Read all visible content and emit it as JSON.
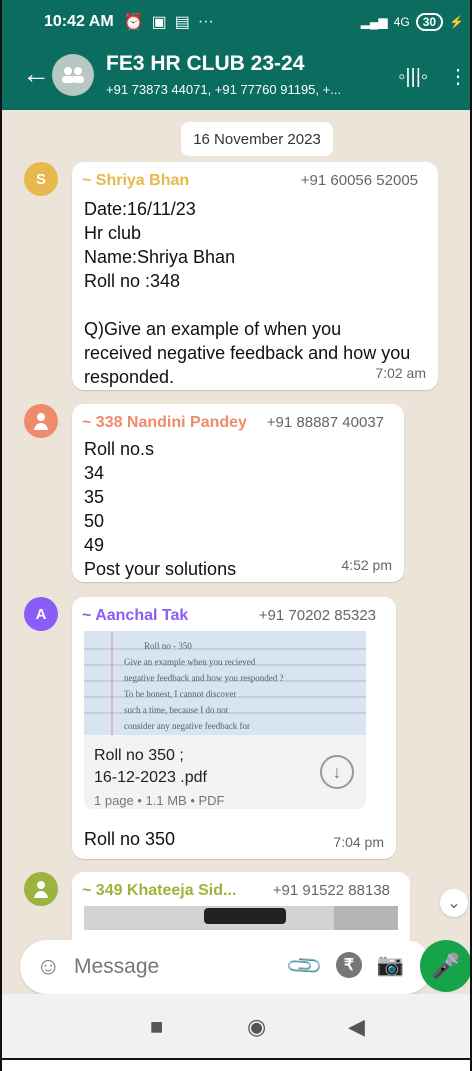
{
  "status": {
    "time": "10:42 AM",
    "battery": "30"
  },
  "header": {
    "title": "FE3 HR CLUB 23-24",
    "subtitle": "+91 73873 44071, +91 77760 91195, +..."
  },
  "chat": {
    "date": "16 November 2023",
    "messages": [
      {
        "avatar": "S",
        "sender": "~ Shriya Bhan",
        "phone": "+91 60056 52005",
        "text": "Date:16/11/23\nHr club\nName:Shriya Bhan\nRoll no :348\n\nQ)Give an example of when you received negative feedback and how you responded.",
        "time": "7:02 am"
      },
      {
        "avatar": "",
        "sender": "~ 338 Nandini Pandey",
        "phone": "+91 88887 40037",
        "text": "Roll no.s\n34\n35\n50\n49\nPost your solutions",
        "time": "4:52 pm"
      },
      {
        "avatar": "A",
        "sender": "~ Aanchal Tak",
        "phone": "+91 70202 85323",
        "document": {
          "name": "Roll no 350 ;\n16-12-2023 .pdf",
          "meta": "1 page • 1.1 MB • PDF",
          "preview_lines": [
            "Roll no - 350",
            "Give an example when you recieved",
            "negative feedback and how you responded ?",
            "To be honest, I cannot discover",
            "such a time, because I do not",
            "consider any negative feedback for"
          ]
        },
        "text": "Roll no 350",
        "time": "7:04 pm"
      },
      {
        "avatar": "",
        "sender": "~ 349 Khateeja Sid...",
        "phone": "+91 91522 88138"
      }
    ]
  },
  "composer": {
    "placeholder": "Message"
  },
  "icons": {
    "back": "back-arrow-icon",
    "group": "group-avatar-icon",
    "audio": "voice-call-icon",
    "menu": "more-options-icon",
    "emoji": "emoji-icon",
    "attach": "paperclip-icon",
    "rupee": "payment-icon",
    "camera": "camera-icon",
    "mic": "mic-icon",
    "down": "scroll-down-icon"
  },
  "colors": {
    "header": "#0b6d5f",
    "chat_bg": "#ece4d9",
    "shriya": "#e7b84b",
    "nandini": "#ef8a6b",
    "aanchal": "#8b5cf6",
    "khateeja": "#9bb43b"
  }
}
